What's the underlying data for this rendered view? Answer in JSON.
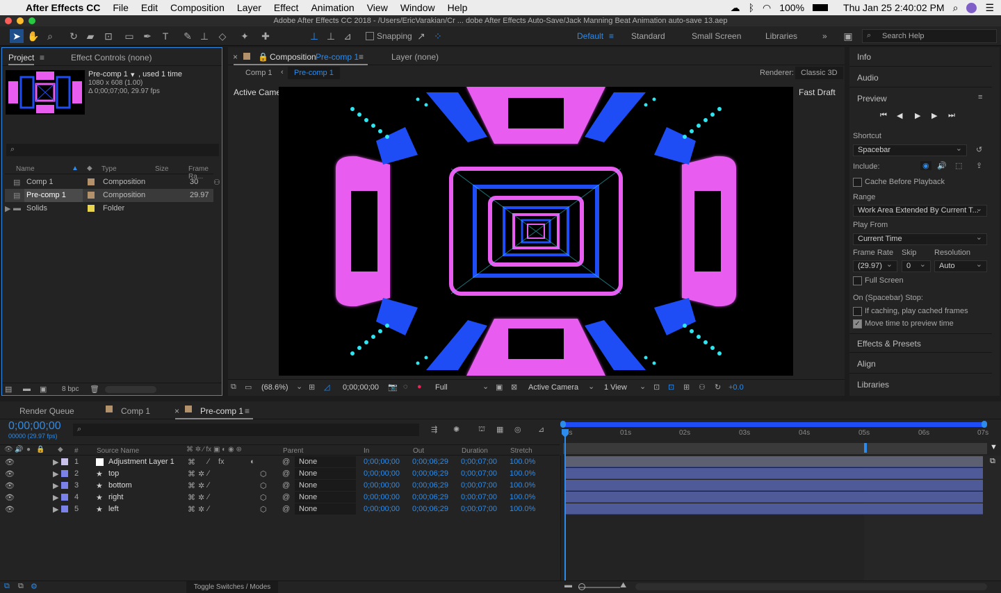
{
  "menubar": {
    "app": "After Effects CC",
    "items": [
      "File",
      "Edit",
      "Composition",
      "Layer",
      "Effect",
      "Animation",
      "View",
      "Window",
      "Help"
    ],
    "battery": "100%",
    "clock": "Thu Jan 25  2:40:02 PM"
  },
  "titlebar": {
    "title": "Adobe After Effects CC 2018 - /Users/EricVarakian/Cr ... dobe After Effects Auto-Save/Jack Manning Beat Animation auto-save 13.aep"
  },
  "toolbar": {
    "snapping": "Snapping",
    "workspaces": [
      "Default",
      "Standard",
      "Small Screen",
      "Libraries"
    ],
    "search_placeholder": "Search Help"
  },
  "project": {
    "tab_project": "Project",
    "tab_effect": "Effect Controls (none)",
    "thumb_name": "Pre-comp 1",
    "used": ", used 1 time",
    "dims": "1080 x 608 (1.00)",
    "duration": "Δ 0;00;07;00, 29.97 fps",
    "cols": {
      "name": "Name",
      "type": "Type",
      "size": "Size",
      "frame_rate": "Frame Ra..."
    },
    "items": [
      {
        "name": "Comp 1",
        "type": "Composition",
        "frame_rate": "30"
      },
      {
        "name": "Pre-comp 1",
        "type": "Composition",
        "frame_rate": "29.97"
      },
      {
        "name": "Solids",
        "type": "Folder",
        "frame_rate": ""
      }
    ],
    "bpc": "8 bpc"
  },
  "comp": {
    "tab_label": "Composition",
    "tab_comp": "Pre-comp 1",
    "layer_tab": "Layer (none)",
    "crumb1": "Comp 1",
    "crumb2": "Pre-comp 1",
    "renderer_label": "Renderer:",
    "renderer": "Classic 3D",
    "active_camera": "Active Camera",
    "fast_draft": "Fast Draft",
    "zoom": "(68.6%)",
    "timecode": "0;00;00;00",
    "resolution": "Full",
    "camera": "Active Camera",
    "views": "1 View",
    "exposure": "+0.0"
  },
  "right": {
    "info": "Info",
    "audio": "Audio",
    "preview": "Preview",
    "shortcut_label": "Shortcut",
    "shortcut": "Spacebar",
    "include": "Include:",
    "cache": "Cache Before Playback",
    "range_label": "Range",
    "range": "Work Area Extended By Current T...",
    "play_from_label": "Play From",
    "play_from": "Current Time",
    "frame_rate_label": "Frame Rate",
    "skip_label": "Skip",
    "resolution_label": "Resolution",
    "frame_rate": "(29.97)",
    "skip": "0",
    "resolution": "Auto",
    "full_screen": "Full Screen",
    "on_stop": "On (Spacebar) Stop:",
    "if_caching": "If caching, play cached frames",
    "move_time": "Move time to preview time",
    "effects": "Effects & Presets",
    "align": "Align",
    "libraries": "Libraries"
  },
  "timeline": {
    "tabs": [
      "Render Queue",
      "Comp 1",
      "Pre-comp 1"
    ],
    "timecode": "0;00;00;00",
    "fps": "00000 (29.97 fps)",
    "cols": {
      "num": "#",
      "source": "Source Name",
      "parent": "Parent",
      "in": "In",
      "out": "Out",
      "duration": "Duration",
      "stretch": "Stretch"
    },
    "layers": [
      {
        "num": "1",
        "name": "Adjustment Layer 1",
        "parent": "None",
        "in": "0;00;00;00",
        "out": "0;00;06;29",
        "duration": "0;00;07;00",
        "stretch": "100.0%"
      },
      {
        "num": "2",
        "name": "top",
        "parent": "None",
        "in": "0;00;00;00",
        "out": "0;00;06;29",
        "duration": "0;00;07;00",
        "stretch": "100.0%"
      },
      {
        "num": "3",
        "name": "bottom",
        "parent": "None",
        "in": "0;00;00;00",
        "out": "0;00;06;29",
        "duration": "0;00;07;00",
        "stretch": "100.0%"
      },
      {
        "num": "4",
        "name": "right",
        "parent": "None",
        "in": "0;00;00;00",
        "out": "0;00;06;29",
        "duration": "0;00;07;00",
        "stretch": "100.0%"
      },
      {
        "num": "5",
        "name": "left",
        "parent": "None",
        "in": "0;00;00;00",
        "out": "0;00;06;29",
        "duration": "0;00;07;00",
        "stretch": "100.0%"
      }
    ],
    "ruler": [
      "0s",
      "01s",
      "02s",
      "03s",
      "04s",
      "05s",
      "06s",
      "07s"
    ],
    "toggle": "Toggle Switches / Modes"
  },
  "colors": {
    "accent": "#2d8ceb",
    "magenta": "#e85cf0",
    "blue": "#1e4df5",
    "cyan": "#2ee6f0",
    "layer_bar": "#4f5b99"
  }
}
